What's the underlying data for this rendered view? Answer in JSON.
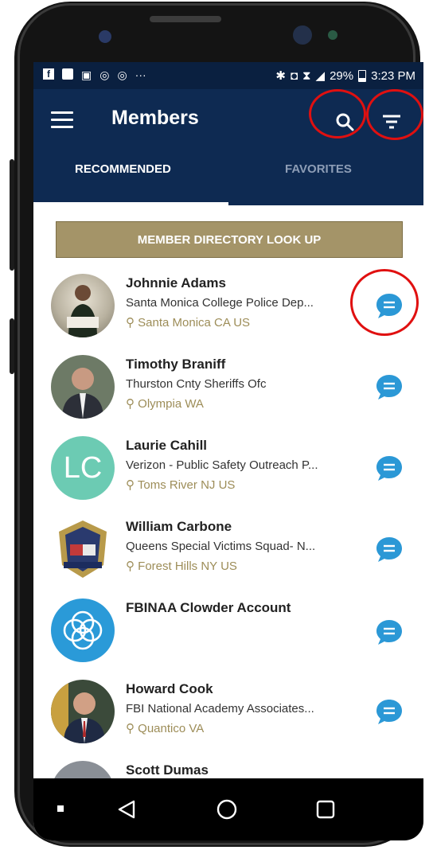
{
  "status_bar": {
    "battery": "29%",
    "time": "3:23 PM"
  },
  "app_bar": {
    "title": "Members"
  },
  "tabs": [
    {
      "label": "RECOMMENDED",
      "active": true
    },
    {
      "label": "FAVORITES",
      "active": false
    }
  ],
  "lookup_button": {
    "label": "MEMBER DIRECTORY LOOK UP"
  },
  "members": [
    {
      "name": "Johnnie Adams",
      "org": "Santa Monica College Police Dep...",
      "location": "Santa Monica CA US",
      "avatar": "photo"
    },
    {
      "name": "Timothy Braniff",
      "org": "Thurston Cnty Sheriffs Ofc",
      "location": "Olympia WA",
      "avatar": "photo"
    },
    {
      "name": "Laurie Cahill",
      "org": "Verizon - Public Safety Outreach P...",
      "location": "Toms River NJ US",
      "avatar": "initials",
      "initials": "LC"
    },
    {
      "name": "William Carbone",
      "org": "Queens Special Victims Squad- N...",
      "location": "Forest Hills NY US",
      "avatar": "badge"
    },
    {
      "name": "FBINAA Clowder Account",
      "org": "",
      "location": "",
      "avatar": "logo"
    },
    {
      "name": "Howard Cook",
      "org": "FBI National Academy Associates...",
      "location": "Quantico VA",
      "avatar": "photo"
    },
    {
      "name": "Scott Dumas",
      "org": "",
      "location": "",
      "avatar": "photo"
    }
  ],
  "icons": {
    "menu": "hamburger-icon",
    "search": "search-icon",
    "filter": "filter-icon",
    "chat": "chat-bubble-icon",
    "location": "location-pin-icon",
    "nav_recent": "square-dot-icon",
    "nav_back": "back-triangle-icon",
    "nav_home": "home-circle-icon",
    "nav_overview": "overview-square-icon"
  },
  "colors": {
    "app_bar": "#0e2a52",
    "status_bar": "#0a2040",
    "lookup_button": "#a49468",
    "location_text": "#9d8d58",
    "chat_bubble": "#2b98d6",
    "annotation_ring": "#e01010",
    "initials_avatar": "#6ccbb3"
  }
}
